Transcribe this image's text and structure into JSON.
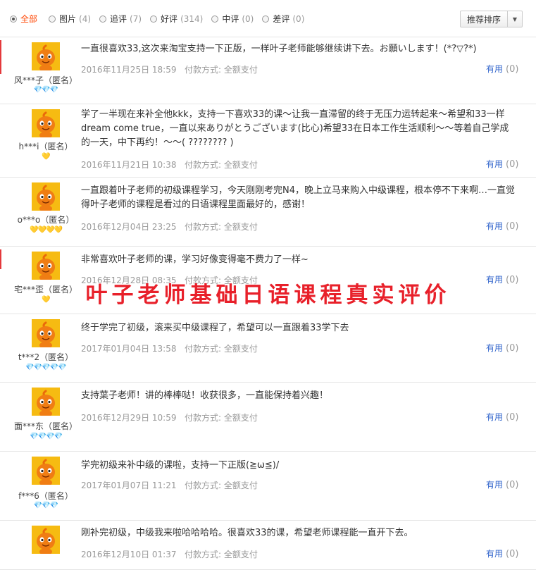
{
  "filters": [
    {
      "label": "全部",
      "count": "",
      "active": true
    },
    {
      "label": "图片",
      "count": "(4)"
    },
    {
      "label": "追评",
      "count": "(7)"
    },
    {
      "label": "好评",
      "count": "(314)"
    },
    {
      "label": "中评",
      "count": "(0)"
    },
    {
      "label": "差评",
      "count": "(0)"
    }
  ],
  "sort_label": "推荐排序",
  "reviews": [
    {
      "user": "风***子（匿名）",
      "badges": "💎💎💎",
      "text": "一直很喜欢33,这次来淘宝支持一下正版，一样叶子老师能够继续讲下去。お願いします！(*?▽?*)",
      "date": "2016年11月25日 18:59",
      "payment": "付款方式: 全额支付",
      "helpful": "有用",
      "helpful_count": "(0)"
    },
    {
      "user": "h***i（匿名）",
      "badges": "💛",
      "text": "学了一半现在来补全他kkk，支持一下喜欢33的课～让我一直滞留的终于无压力运转起来～希望和33一样dream come true，一直以来ありがとうございます(比心)希望33在日本工作生活顺利～～等着自己学成的一天，中下再约！～～( ???????? )",
      "date": "2016年11月21日 10:38",
      "payment": "付款方式: 全额支付",
      "helpful": "有用",
      "helpful_count": "(0)"
    },
    {
      "user": "o***o（匿名）",
      "badges": "💛💛💛💛",
      "text": "一直跟着叶子老师的初级课程学习，今天刚刚考完N4，晚上立马来购入中级课程，根本停不下来啊…一直觉得叶子老师的课程是看过的日语课程里面最好的，感谢！",
      "date": "2016年12月04日 23:25",
      "payment": "付款方式: 全额支付",
      "helpful": "有用",
      "helpful_count": "(0)"
    },
    {
      "user": "宅***歪（匿名）",
      "badges": "💛",
      "text": "非常喜欢叶子老师的课，学习好像变得毫不费力了一样~",
      "date": "2016年12月28日 08:35",
      "payment": "付款方式: 全额支付",
      "helpful": "有用",
      "helpful_count": "(0)"
    },
    {
      "user": "t***2（匿名）",
      "badges": "💎💎💎💎💎",
      "text": "终于学完了初级，滚来买中级课程了，希望可以一直跟着33学下去",
      "date": "2017年01月04日 13:58",
      "payment": "付款方式: 全额支付",
      "helpful": "有用",
      "helpful_count": "(0)"
    },
    {
      "user": "面***东（匿名）",
      "badges": "💎💎💎💎",
      "text": "支持葉子老师！讲的棒棒哒！收获很多，一直能保持着兴趣！",
      "date": "2016年12月29日 10:59",
      "payment": "付款方式: 全额支付",
      "helpful": "有用",
      "helpful_count": "(0)"
    },
    {
      "user": "f***6（匿名）",
      "badges": "💎💎💎",
      "text": "学完初级来补中级的课啦，支持一下正版(≧ω≦)/",
      "date": "2017年01月07日 11:21",
      "payment": "付款方式: 全额支付",
      "helpful": "有用",
      "helpful_count": "(0)"
    },
    {
      "user": "",
      "badges": "",
      "text": "刚补完初级，中级我来啦哈哈哈哈。很喜欢33的课，希望老师课程能一直开下去。",
      "date": "2016年12月10日 01:37",
      "payment": "付款方式: 全额支付",
      "helpful": "有用",
      "helpful_count": "(0)"
    }
  ],
  "overlay_text": "叶子老师基础日语课程真实评价"
}
